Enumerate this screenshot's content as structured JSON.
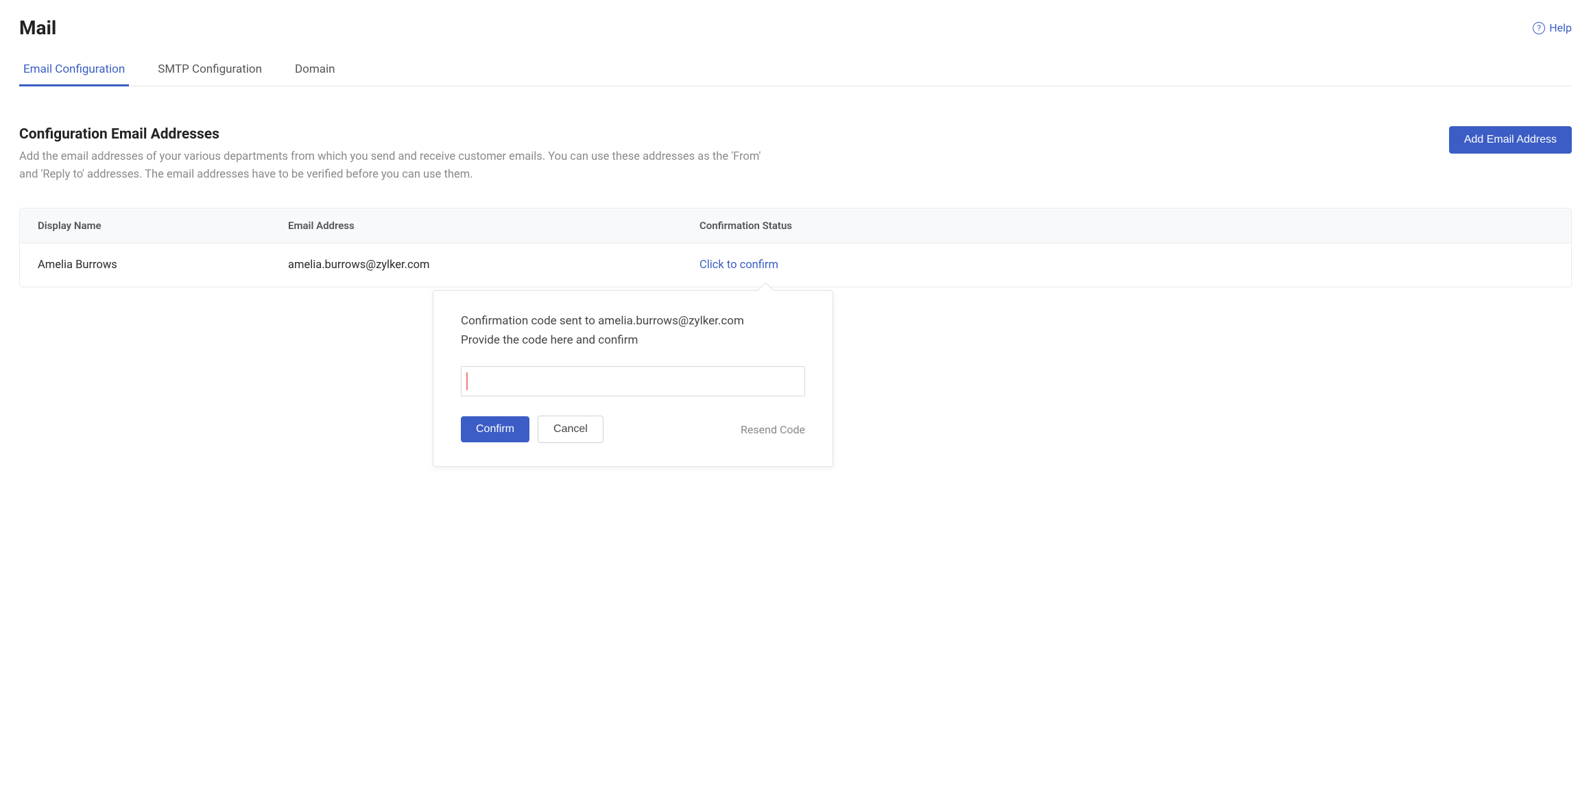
{
  "header": {
    "title": "Mail",
    "help_label": "Help"
  },
  "tabs": [
    {
      "label": "Email Configuration",
      "active": true
    },
    {
      "label": "SMTP Configuration",
      "active": false
    },
    {
      "label": "Domain",
      "active": false
    }
  ],
  "section": {
    "title": "Configuration Email Addresses",
    "description": "Add the email addresses of your various departments from which you send and receive customer emails. You can use these addresses as the 'From' and 'Reply to' addresses. The email addresses have to be verified before you can use them.",
    "add_button_label": "Add Email Address"
  },
  "table": {
    "columns": {
      "display_name": "Display Name",
      "email_address": "Email Address",
      "confirmation_status": "Confirmation Status"
    },
    "rows": [
      {
        "display_name": "Amelia Burrows",
        "email_address": "amelia.burrows@zylker.com",
        "confirmation_status_label": "Click to confirm"
      }
    ]
  },
  "popover": {
    "line1": "Confirmation code sent to amelia.burrows@zylker.com",
    "line2": "Provide the code here and confirm",
    "input_value": "",
    "confirm_label": "Confirm",
    "cancel_label": "Cancel",
    "resend_label": "Resend Code"
  }
}
